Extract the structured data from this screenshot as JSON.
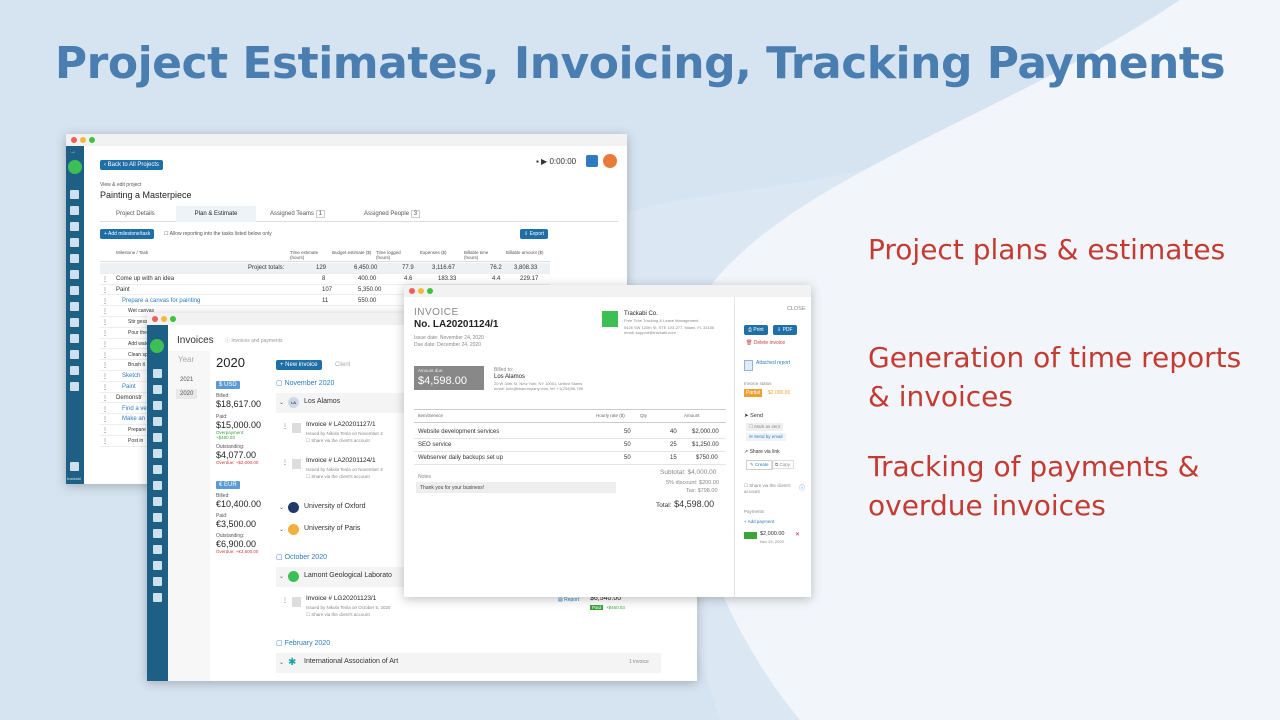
{
  "headline": "Project Estimates, Invoicing, Tracking Payments",
  "features": [
    "Project plans & estimates",
    "Generation of time reports & invoices",
    "Tracking of payments & overdue invoices"
  ],
  "colors": {
    "accent_blue": "#4a7eb0",
    "feature_red": "#c43b32",
    "sidebar": "#1e5f86",
    "brand_green": "#3cbf55"
  },
  "project_window": {
    "back_button": "Back to All Projects",
    "timer": "0:00:00",
    "subtitle": "View & edit project",
    "project_name": "Painting a Masterpiece",
    "tabs": [
      {
        "label": "Project Details",
        "count": ""
      },
      {
        "label": "Plan & Estimate",
        "count": ""
      },
      {
        "label": "Assigned Teams",
        "count": "1"
      },
      {
        "label": "Assigned People",
        "count": "3"
      }
    ],
    "add_button": "+ Add milestone/task",
    "allow_reporting": "Allow reporting into the tasks listed below only",
    "export_button": "Export",
    "columns": [
      "Milestone / Task",
      "Time estimate (hours)",
      "Budget estimate ($)",
      "Time logged (hours)",
      "Expenses ($)",
      "Billable time (hours)",
      "Billable amount ($)"
    ],
    "totals": {
      "label": "Project totals:",
      "values": [
        "129",
        "6,450.00",
        "77.9",
        "3,116.67",
        "76.2",
        "3,808.33"
      ]
    },
    "rows": [
      {
        "name": "Come up with an idea",
        "level": 0,
        "values": [
          "8",
          "400.00",
          "4.6",
          "183.33",
          "4.4",
          "229.17"
        ]
      },
      {
        "name": "Paint",
        "level": 0,
        "values": [
          "107",
          "5,350.00",
          "",
          "",
          "",
          ""
        ]
      },
      {
        "name": "Prepare a canvas for painting",
        "level": 1,
        "values": [
          "11",
          "550.00",
          "",
          "",
          "",
          ""
        ]
      },
      {
        "name": "Wet canvas",
        "level": 2,
        "values": [
          "",
          "",
          "",
          "",
          "",
          ""
        ]
      },
      {
        "name": "Stir gesso",
        "level": 2,
        "values": [
          "",
          "",
          "",
          "",
          "",
          ""
        ]
      },
      {
        "name": "Pour the",
        "level": 2,
        "values": [
          "",
          "",
          "",
          "",
          "",
          ""
        ]
      },
      {
        "name": "Add wate",
        "level": 2,
        "values": [
          "",
          "",
          "",
          "",
          "",
          ""
        ]
      },
      {
        "name": "Clean sp",
        "level": 2,
        "values": [
          "",
          "",
          "",
          "",
          "",
          ""
        ]
      },
      {
        "name": "Brush it",
        "level": 2,
        "values": [
          "",
          "",
          "",
          "",
          "",
          ""
        ]
      },
      {
        "name": "Sketch",
        "level": 1,
        "values": [
          "",
          "",
          "",
          "",
          "",
          ""
        ]
      },
      {
        "name": "Paint",
        "level": 1,
        "values": [
          "",
          "",
          "",
          "",
          "",
          ""
        ]
      },
      {
        "name": "Demonstr",
        "level": 0,
        "values": [
          "",
          "",
          "",
          "",
          "",
          ""
        ]
      },
      {
        "name": "Find a ven",
        "level": 1,
        "values": [
          "",
          "",
          "",
          "",
          "",
          ""
        ]
      },
      {
        "name": "Make an",
        "level": 1,
        "values": [
          "",
          "",
          "",
          "",
          "",
          ""
        ]
      },
      {
        "name": "Prepare a",
        "level": 2,
        "values": [
          "",
          "",
          "",
          "",
          "",
          ""
        ]
      },
      {
        "name": "Post in",
        "level": 2,
        "values": [
          "",
          "",
          "",
          "",
          "",
          ""
        ]
      }
    ],
    "brand": "trackabi"
  },
  "invoices_window": {
    "title": "Invoices",
    "help": "Invoices and payments",
    "year_label": "Year",
    "years": [
      "2021",
      "2020"
    ],
    "selected_year": "2020",
    "new_invoice": "+ New invoice",
    "client_label": "Client",
    "usd": {
      "currency": "$ USD",
      "billed_label": "Billed:",
      "billed": "$18,617.00",
      "paid_label": "Paid:",
      "paid": "$15,000.00",
      "overpayment": "Overpayment: +$460.03",
      "outstanding_label": "Outstanding:",
      "outstanding": "$4,077.00",
      "overdue": "Overdue: +$2,000.00"
    },
    "eur": {
      "currency": "€ EUR",
      "billed_label": "Billed:",
      "billed": "€10,400.00",
      "paid_label": "Paid:",
      "paid": "€3,500.00",
      "outstanding_label": "Outstanding:",
      "outstanding": "€6,900.00",
      "overdue": "Overdue: +€3,600.00"
    },
    "month1": "November 2020",
    "client1": "Los Alamos",
    "inv1": {
      "number": "Invoice # LA20201127/1",
      "issued": "Issued by Nikola Tesla on November 2",
      "share": "Share via the client's account"
    },
    "inv2": {
      "number": "Invoice # LA20201124/1",
      "issued": "Issued by Nikola Tesla on November 2",
      "share": "Share via the client's account"
    },
    "client2": "University of Oxford",
    "client3": "University of Paris",
    "month2": "October 2020",
    "client4": "Lamont Geological Laborato",
    "inv3": {
      "number": "Invoice # LG20201123/1",
      "issued": "Issued by Nikola Tesla on October 5, 2020",
      "share": "Share via the client's account",
      "report": "Report",
      "amount": "$6,540.00",
      "paid_badge": "Paid",
      "extra": "+$460.03"
    },
    "month3": "February 2020",
    "client5": "International Association of Art",
    "client5_count": "1 invoice"
  },
  "invoice_window": {
    "heading": "INVOICE",
    "number": "No. LA20201124/1",
    "issue_date": "Issue date: November 24, 2020",
    "due_date": "Due date: December 24, 2020",
    "company": "Trackabi Co.",
    "company_tag": "Free Time Tracking & Leave Management",
    "company_addr": "5426 SW 120th St, STE 103-277, Miami, FL 33186",
    "company_email": "email: support@trackabi.com",
    "amount_due_label": "Amount due:",
    "amount_due": "$4,598.00",
    "billed_to_label": "Billed to:",
    "billed_to": "Los Alamos",
    "billed_addr": "20 W 34th St, New York, NY 10001, United States",
    "billed_email": "email: lorio@lawcompany.com, tel: +1(234)56-789",
    "columns": [
      "Item/Service",
      "Hourly rate ($)",
      "Qty",
      "Amount"
    ],
    "lines": [
      {
        "item": "Website development services",
        "rate": "50",
        "qty": "40",
        "amount": "$2,000.00"
      },
      {
        "item": "SEO service",
        "rate": "50",
        "qty": "25",
        "amount": "$1,250.00"
      },
      {
        "item": "Webserver daily backups set up",
        "rate": "50",
        "qty": "15",
        "amount": "$750.00"
      }
    ],
    "subtotal_label": "Subtotal:",
    "subtotal": "$4,000.00",
    "discount_label": "5% discount:",
    "discount": "$200.00",
    "tax_label": "Tax:",
    "tax": "$798.00",
    "total_label": "Total:",
    "total": "$4,598.00",
    "notes_label": "Notes",
    "notes": "Thank you for your business!",
    "close": "CLOSE",
    "print": "Print",
    "pdf": "PDF",
    "delete": "Delete invoice",
    "attached": "Attached report",
    "status_label": "Invoice status",
    "status": "Partial",
    "status_amount": "$2,000.00",
    "send_label": "Send",
    "mark_sent": "Mark as sent",
    "send_email": "Send by email",
    "share_link": "Share via link",
    "create": "Create",
    "copy": "Copy",
    "share_client": "Share via the client's account",
    "payments_label": "Payments",
    "add_payment": "+ Add payment",
    "payment_amount": "$2,000.00",
    "payment_date": "Nov 24, 2020"
  }
}
